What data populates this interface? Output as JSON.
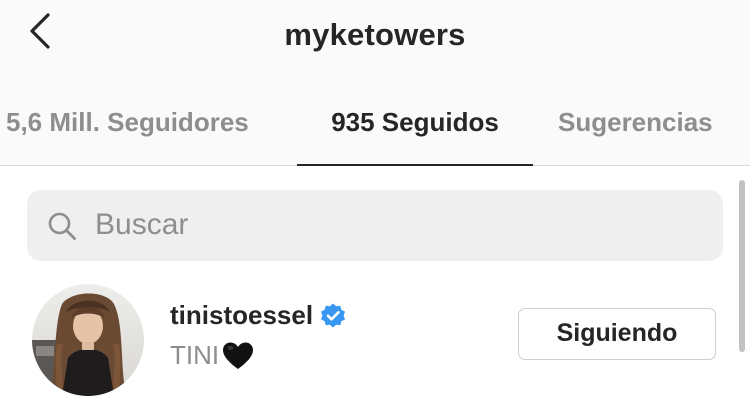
{
  "header": {
    "back_icon": "chevron-left-icon",
    "title": "myketowers"
  },
  "tabs": [
    {
      "label": "5,6 Mill. Seguidores",
      "active": false
    },
    {
      "label": "935 Seguidos",
      "active": true
    },
    {
      "label": "Sugerencias",
      "active": false
    }
  ],
  "search": {
    "placeholder": "Buscar",
    "value": "",
    "icon": "search-icon"
  },
  "following_list": [
    {
      "username": "tinistoessel",
      "verified": true,
      "full_name": "TINI",
      "name_emoji": "black-heart",
      "button_label": "Siguiendo"
    }
  ],
  "colors": {
    "background": "#fafafa",
    "text_primary": "#262626",
    "text_secondary": "#8e8e8e",
    "verified_badge": "#3897f0",
    "search_bg": "#efefef"
  }
}
